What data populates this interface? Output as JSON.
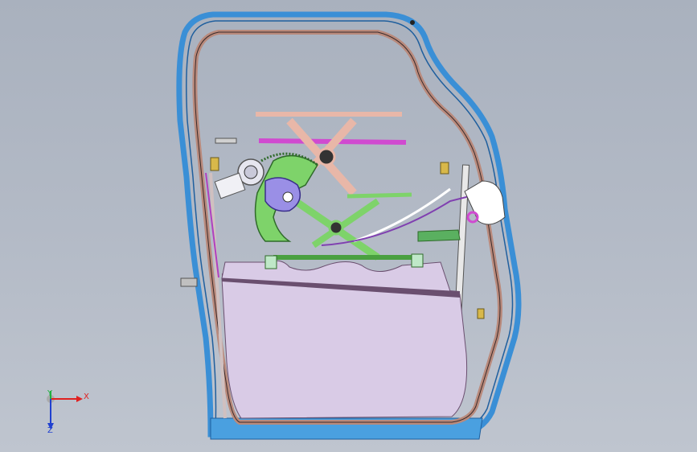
{
  "viewport": {
    "background_top": "#a9b1be",
    "background_bottom": "#bfc5cf"
  },
  "triad": {
    "x_label": "X",
    "y_label": "Y",
    "z_label": "Z",
    "x_color": "#e02020",
    "y_color": "#20b040",
    "z_color": "#2040d0"
  },
  "model": {
    "outer_seal_color": "#3a8fd6",
    "inner_frame_color": "#b98a7c",
    "scissor_top_color": "#e8b7a8",
    "rail_magenta_color": "#d04ad0",
    "sector_gear_color": "#7ed36a",
    "motor_color": "#9a8fe6",
    "glass_color": "#d9cbe6",
    "glass_edge_color": "#6a4f6f"
  }
}
